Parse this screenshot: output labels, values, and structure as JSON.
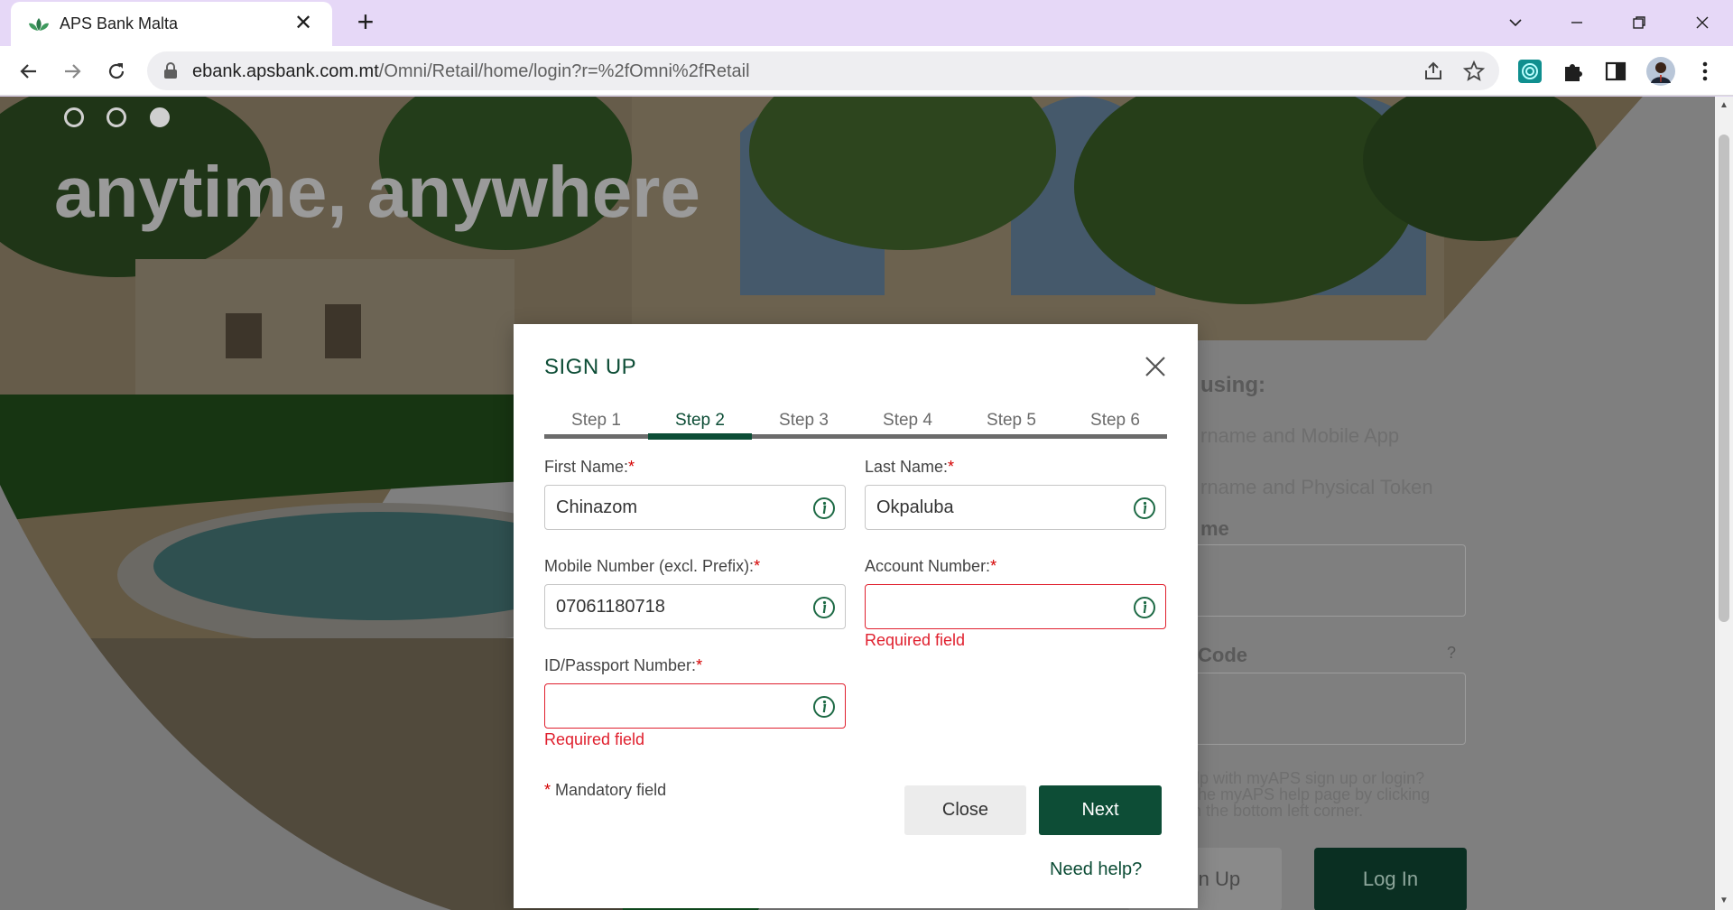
{
  "browser": {
    "tab_title": "APS Bank Malta",
    "url_host": "ebank.apsbank.com.mt",
    "url_path": "/Omni/Retail/home/login?r=%2fOmni%2fRetail"
  },
  "hero": {
    "title": "anytime, anywhere"
  },
  "background_login": {
    "heading_fragment": "using:",
    "option1_fragment": "rname and Mobile App",
    "option2_fragment": "rname and Physical Token",
    "username_fragment": "me",
    "code_fragment": "Code",
    "help_q": "?",
    "help_line1": "lp with myAPS sign up or login?",
    "help_line2": "he myAPS help page by clicking",
    "help_line3": "on Help in the bottom left corner.",
    "signup_label": "Sign Up",
    "login_label": "Log In"
  },
  "modal": {
    "title": "SIGN UP",
    "steps": [
      "Step 1",
      "Step 2",
      "Step 3",
      "Step 4",
      "Step 5",
      "Step 6"
    ],
    "active_step_index": 1,
    "fields": {
      "first_name": {
        "label": "First Name:",
        "value": "Chinazom"
      },
      "last_name": {
        "label": "Last Name:",
        "value": "Okpaluba"
      },
      "mobile": {
        "label": "Mobile Number (excl. Prefix):",
        "value": "07061180718"
      },
      "account": {
        "label": "Account Number:",
        "value": "",
        "error": "Required field"
      },
      "id_passport": {
        "label": "ID/Passport Number:",
        "value": "",
        "error": "Required field"
      }
    },
    "required_marker": "*",
    "mandatory_note": "Mandatory field",
    "close_label": "Close",
    "next_label": "Next",
    "need_help": "Need help?"
  },
  "colors": {
    "brand_green": "#0d4d36",
    "error_red": "#e0202e",
    "tab_strip": "#e6d8f7"
  }
}
